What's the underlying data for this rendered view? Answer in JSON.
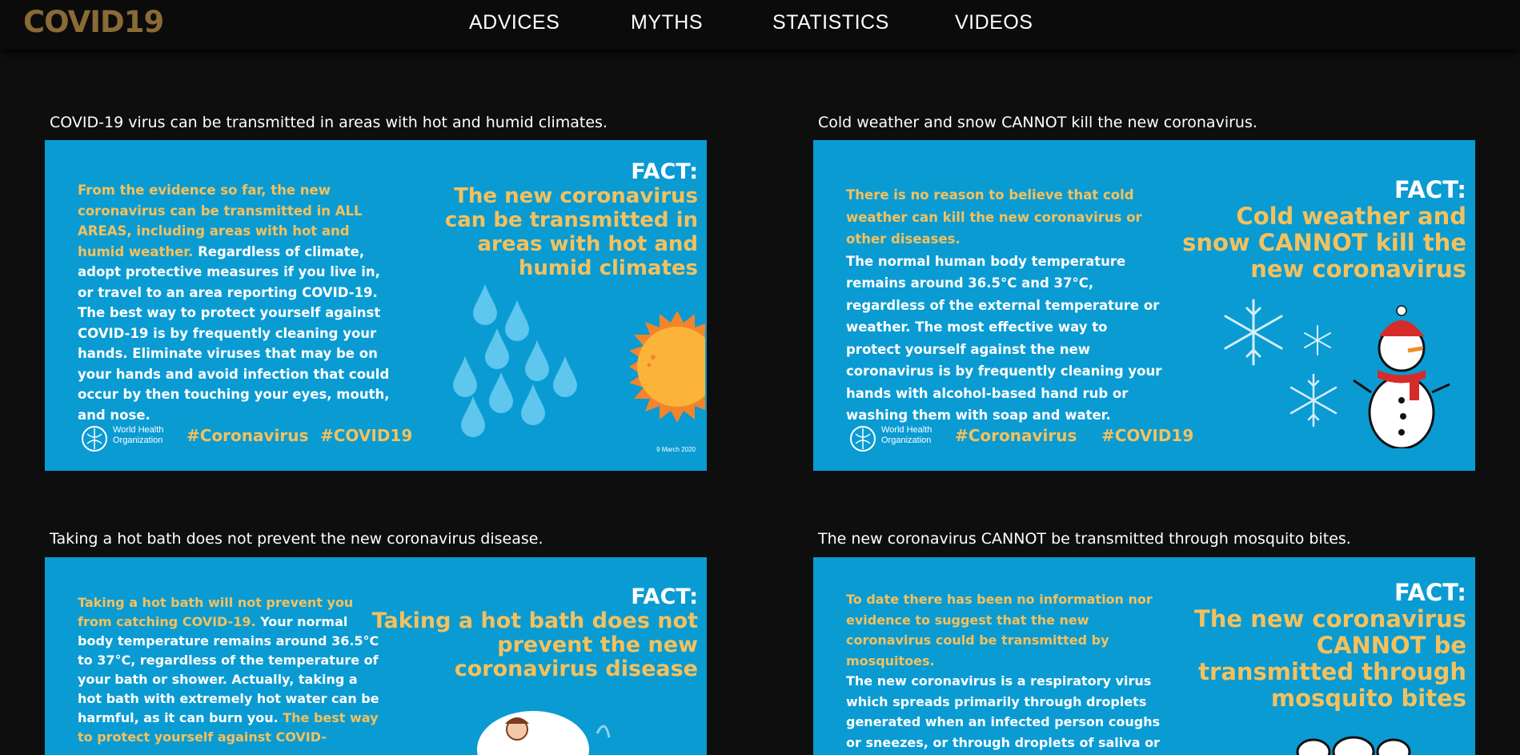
{
  "brand": "COVID19",
  "nav": [
    "ADVICES",
    "MYTHS",
    "STATISTICS",
    "VIDEOS"
  ],
  "cards": [
    {
      "title": "COVID-19 virus can be transmitted in areas with hot and humid climates.",
      "body_yellow": "From the evidence so far, the new coronavirus can be transmitted in ALL AREAS, including areas with hot and humid weather.",
      "body_white": "Regardless of climate, adopt protective measures if you live in, or travel to an area reporting COVID-19. The best way to protect yourself against COVID-19 is by frequently cleaning your hands. Eliminate viruses that may be on your hands and avoid infection that could occur by then touching your eyes, mouth, and nose.",
      "fact_label": "FACT:",
      "fact_text": "The new coronavirus can be transmitted in areas with hot and humid climates",
      "org": "World Health Organization",
      "hashtag1": "#Coronavirus",
      "hashtag2": "#COVID19",
      "date": "9 March 2020"
    },
    {
      "title": "Cold weather and snow CANNOT kill the new coronavirus.",
      "body_yellow": "There is no reason to believe that cold weather can kill the new coronavirus or other diseases.",
      "body_white": "The normal human body temperature remains around 36.5°C and 37°C, regardless of the external temperature or weather. The most effective way to protect yourself against the new coronavirus is by frequently cleaning your hands with alcohol-based hand rub or washing them with soap and water.",
      "fact_label": "FACT:",
      "fact_text": "Cold weather and snow CANNOT kill the new coronavirus",
      "org": "World Health Organization",
      "hashtag1": "#Coronavirus",
      "hashtag2": "#COVID19"
    },
    {
      "title": "Taking a hot bath does not prevent the new coronavirus disease.",
      "body_yellow": "Taking a hot bath will not prevent you from catching COVID-19.",
      "body_white": "Your normal body temperature remains around 36.5°C to 37°C, regardless of the temperature of your bath or shower. Actually, taking a hot bath with extremely hot water can be harmful, as it can burn you.",
      "body_yellow2": "The best way to protect yourself against COVID-",
      "fact_label": "FACT:",
      "fact_text": "Taking a hot bath does not prevent the new coronavirus disease"
    },
    {
      "title": "The new coronavirus CANNOT be transmitted through mosquito bites.",
      "body_yellow": "To date there has been no information nor evidence to suggest that the new coronavirus could be transmitted by mosquitoes.",
      "body_white": "The new coronavirus is a respiratory virus which spreads primarily through droplets generated when an infected person coughs or sneezes, or through droplets of saliva or discharge from the nose.",
      "fact_label": "FACT:",
      "fact_text": "The new coronavirus CANNOT be transmitted through mosquito bites"
    }
  ],
  "colors": {
    "background": "#0e0e0f",
    "brand": "#8a6a35",
    "poster_blue": "#0a9bd3",
    "poster_yellow": "#f4c15d"
  }
}
